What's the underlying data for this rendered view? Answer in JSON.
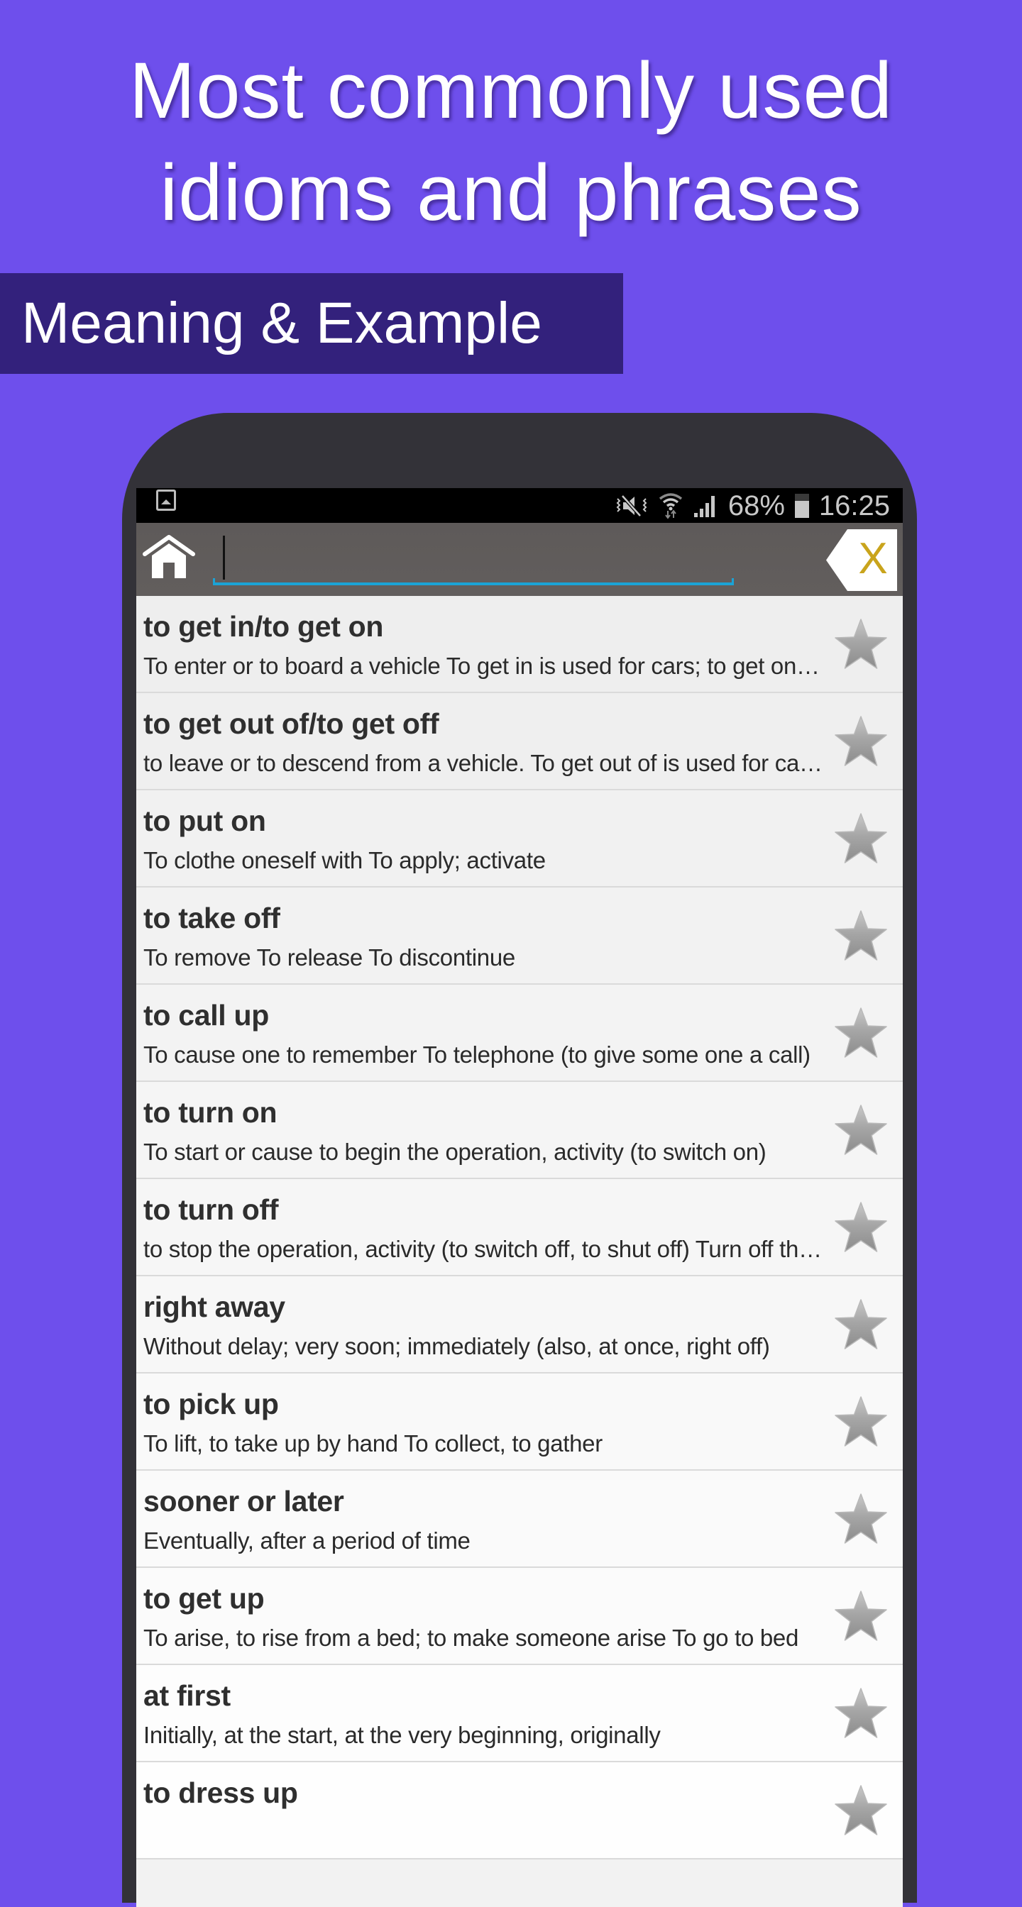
{
  "promo": {
    "headline_line1": "Most commonly used",
    "headline_line2": "idioms and phrases",
    "subbanner": "Meaning & Example"
  },
  "colors": {
    "background": "#6e4fec",
    "subbanner": "#33217c",
    "phone_body": "#333238",
    "toolbar": "#605c5b",
    "search_underline": "#1ba3d6",
    "clear_x": "#c9a41c",
    "star": "#9a9a9a"
  },
  "statusbar": {
    "left_icons": [
      "gallery-icon"
    ],
    "right_icons": [
      "mute-vibrate-icon",
      "wifi-data-icon",
      "signal-icon"
    ],
    "battery_percent": "68%",
    "battery_level": 0.68,
    "time": "16:25"
  },
  "toolbar": {
    "home_icon": "home-icon",
    "search_value": "",
    "search_placeholder": "",
    "clear_label": "X"
  },
  "list": {
    "items": [
      {
        "title": "to get in/to get on",
        "description": "To enter or to board a vehicle To get in is used for cars; to get on is used for buses, trains",
        "favorite": false
      },
      {
        "title": "to get out of/to get off",
        "description": "to leave or to descend from a vehicle. To get out of is used for cars; to get off is used for buses",
        "favorite": false
      },
      {
        "title": "to put on",
        "description": "To clothe oneself with  To apply; activate",
        "favorite": false
      },
      {
        "title": "to take off",
        "description": "To remove  To release  To discontinue",
        "favorite": false
      },
      {
        "title": "to call up",
        "description": "To cause one to remember   To telephone (to give some one a call)",
        "favorite": false
      },
      {
        "title": "to turn on",
        "description": "To start or cause to begin the operation, activity (to switch on)",
        "favorite": false
      },
      {
        "title": "to turn off",
        "description": "to stop the operation, activity (to switch off, to shut off)  Turn off the road",
        "favorite": false
      },
      {
        "title": "right away",
        "description": "Without delay; very soon; immediately (also, at once, right off)",
        "favorite": false
      },
      {
        "title": "to pick up",
        "description": "To lift, to take up by hand   To collect, to gather",
        "favorite": false
      },
      {
        "title": "sooner or later",
        "description": "Eventually, after a period of time",
        "favorite": false
      },
      {
        "title": "to get up",
        "description": "To arise, to rise from a bed; to make someone arise   To go to bed",
        "favorite": false
      },
      {
        "title": "at first",
        "description": "Initially, at the start, at the very beginning, originally",
        "favorite": false
      },
      {
        "title": "to dress up",
        "description": "",
        "favorite": false
      }
    ]
  }
}
